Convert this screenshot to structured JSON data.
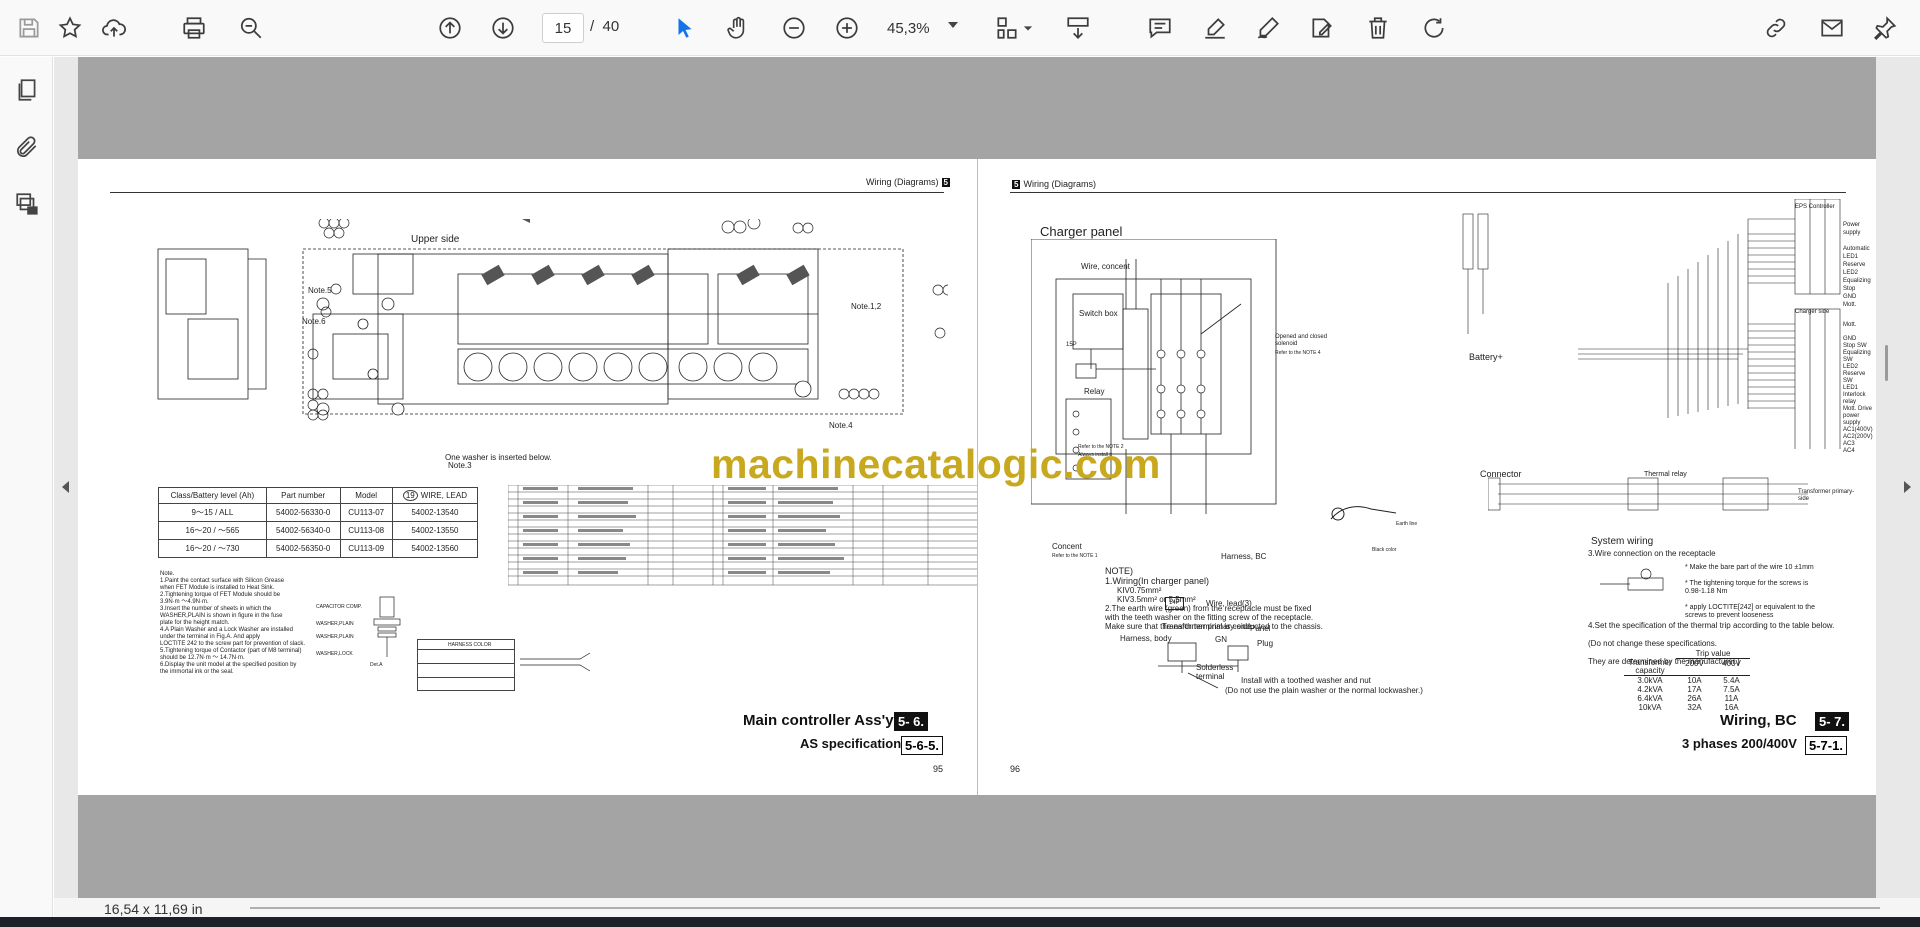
{
  "toolbar": {
    "icons": [
      "save-icon",
      "bookmark-star-icon",
      "upload-cloud-icon",
      "print-icon",
      "zoom-search-icon",
      "page-up-icon",
      "page-down-icon",
      "select-cursor-icon",
      "hand-pan-icon",
      "zoom-out-icon",
      "zoom-in-icon",
      "fit-page-icon",
      "scroll-mode-icon",
      "comment-icon",
      "highlight-pen-icon",
      "draw-pen-icon",
      "stamp-edit-icon",
      "delete-trash-icon",
      "rotate-icon",
      "share-link-icon",
      "email-icon"
    ],
    "current_page": "15",
    "page_separator": "/",
    "total_pages": "40",
    "zoom": "45,3%"
  },
  "sidebar": {
    "icons": [
      "page-thumbnails-icon",
      "attachment-paperclip-icon",
      "layers-lock-icon"
    ]
  },
  "status": {
    "page_size": "16,54 x 11,69 in"
  },
  "watermark": "machinecatalogic.com",
  "left_page": {
    "header_title": "Wiring (Diagrams)",
    "header_num": "5",
    "upper_side_label": "Upper side",
    "notes": [
      "Note.5",
      "Note.6",
      "Note.1,2",
      "Note.4",
      "One washer is inserted below.",
      "Note.3"
    ],
    "spec_table": {
      "headers": [
        "Class/Battery level (Ah)",
        "Part number",
        "Model",
        "WIRE, LEAD"
      ],
      "wire_col_num": "19",
      "rows": [
        [
          "9～15 / ALL",
          "54002-56330-0",
          "CU113-07",
          "54002-13540"
        ],
        [
          "16～20 / ～565",
          "54002-56340-0",
          "CU113-08",
          "54002-13550"
        ],
        [
          "16～20 / ～730",
          "54002-56350-0",
          "CU113-09",
          "54002-13560"
        ]
      ]
    },
    "note_text": [
      "Note.",
      "1.Paint the contact surface with Silicon Grease",
      "  when FET Module is installed to Heat Sink.",
      "2.Tightening torque of FET Module should be",
      "  3.9N·m ～4.9N·m.",
      "3.Insert the number of sheets in which the",
      "  WASHER,PLAIN is shown in figure in the fuse",
      "  plate for the height match.",
      "4.A Plain Washer and a Lock Washer are installed",
      "  under the terminal in Fig.A. And apply",
      "  LOCTITE 242 to the screw part for prevention of slack.",
      "5.Tightening torque of Contactor (part of M8 terminal)",
      "  should be 12.7N·m ～ 14.7N·m.",
      "6.Display the unit model at the specified position by",
      "  the immortal ink or the seal."
    ],
    "washer_labels": [
      "CAPACITOR COMP.",
      "WASHER,PLAIN",
      "WASHER,PLAIN",
      "WASHER,LOCK",
      "Det.A"
    ],
    "harness_color_title": "HARNESS COLOR",
    "caption_main": "Main controller Ass'y",
    "caption_main_num": "5- 6.",
    "caption_sub": "AS specification",
    "caption_sub_num": "5-6-5.",
    "page_number": "95"
  },
  "right_page": {
    "header_num": "5",
    "header_title": "Wiring (Diagrams)",
    "labels": {
      "charger_panel": "Charger panel",
      "wire_concent": "Wire, concent",
      "switch_box": "Switch box",
      "relay": "Relay",
      "opened_closed": "Opened and closed solenoid",
      "refer_note4": "Refer to the NOTE 4",
      "refer_note2": "Refer to the NOTE 2",
      "always_install": "Always install it",
      "concent": "Concent",
      "refer_note1": "Refer to the NOTE 1",
      "harness_bc": "Harness, BC",
      "wire_lead": "Wire, lead(3)",
      "transformer_primary": "Transformer primary-side",
      "harness_body": "Harness, body",
      "tag_14p": "14P",
      "tag_15p": "15P",
      "battery": "Battery+",
      "connector": "Connector",
      "thermal_relay": "Thermal relay",
      "transformer_ps": "Transformer primary-side",
      "earth_line": "Earth line",
      "black_color": "Black color"
    },
    "notes": [
      "NOTE)",
      "1.Wiring(In charger panel)",
      "  KIV0.75mm²",
      "  KIV3.5mm² or 5.5mm²",
      "2.The earth wire (green) from the receptacle must be fixed",
      "  with the teeth washer on the fitting screw of the receptacle.",
      "  Make sure that the earth terminal is conducted to the chassis."
    ],
    "install_note": "Install with a toothed washer and nut",
    "install_note2": "(Do not use the plain washer or the normal lockwasher.)",
    "system_wiring": "System wiring",
    "note3": "3.Wire connection on the receptacle",
    "note3_bullets": [
      "* Make the bare part of the wire 10 ±1mm",
      "* The tightening torque for the screws is 0.98-1.18 Nm",
      "* apply LOCTITE[242] or equivalent to the screws to prevent looseness"
    ],
    "note4": [
      "4.Set the specification of the thermal trip according to the table below.",
      "  (Do not change these specifications.",
      "  They are determined by the manufacturer.)"
    ],
    "trip_table": {
      "headers": [
        "Transformer capacity",
        "200V",
        "400V"
      ],
      "trip_title": "Trip value",
      "rows": [
        [
          "3.0kVA",
          "10A",
          "5.4A"
        ],
        [
          "4.2kVA",
          "17A",
          "7.5A"
        ],
        [
          "6.4kVA",
          "26A",
          "11A"
        ],
        [
          "10kVA",
          "32A",
          "16A"
        ]
      ]
    },
    "eps_controller": "EPS Controller",
    "charger_side": "Charger side",
    "signal_labels": [
      "Power supply",
      "Automatic",
      "LED1",
      "Reserve",
      "LED2",
      "Equalizing",
      "Stop",
      "GND",
      "Mott."
    ],
    "signal_labels2": [
      "Mott.",
      "GND",
      "Stop SW",
      "Equalizing SW",
      "LED2",
      "Reserve SW",
      "LED1",
      "Interlock relay",
      "Mott. Drive power supply",
      "AC1(400V)",
      "AC2(200V)",
      "AC3",
      "AC4"
    ],
    "caption_main": "Wiring, BC",
    "caption_main_num": "5- 7.",
    "caption_sub": "3 phases 200/400V",
    "caption_sub_num": "5-7-1.",
    "page_number": "96"
  }
}
